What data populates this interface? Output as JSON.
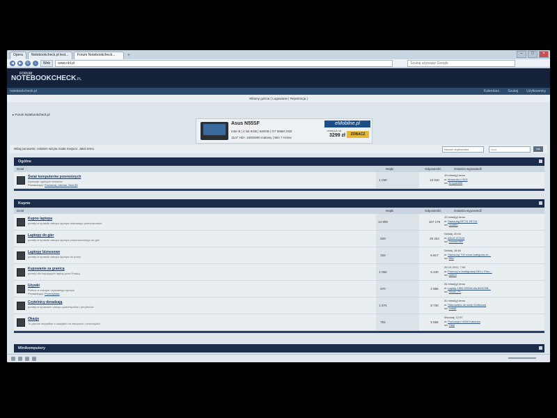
{
  "browser": {
    "tabs": [
      "Opera",
      "Notebookcheck.pl test...",
      "Forum Notebookcheck..."
    ],
    "nav_web_label": "Web",
    "url": "www.nbl.pl",
    "search_placeholder": "Szukaj używając Google"
  },
  "forum": {
    "logo_small": "FORUM",
    "logo_main": "NOTEBOOKCHECK",
    "logo_tld": ".PL",
    "site_link": "notebookcheck.pl",
    "top_links": [
      "Kalendarz",
      "Szukaj",
      "Użytkownicy"
    ],
    "welcome": "Witamy gościa ( Logowanie | Rejestracja )",
    "breadcrumb": "Forum Notebookcheck.pl",
    "greeting": "Witaj ponownie; ostatnie wizyta miała miejsce: Jakiś temu",
    "login_user_placeholder": "Nazwa użytkownika",
    "login_pass_placeholder": "••••••",
    "login_button": "Idź"
  },
  "banner": {
    "title": "Asus N55SF",
    "spec_line1": "Intel i5 | 4 lub 8GB | 640GB | GT 555M 2GB",
    "spec_line2": "15,6\" HD+ 1600x900 matowy | Win 7 Home",
    "shop": "eMobilne.pl",
    "price_label": "cena już od",
    "price": "3299 zł",
    "cta": "ZOBACZ"
  },
  "columns": {
    "forum": "Dział",
    "threads": "Wątki",
    "posts": "Odpowiedzi",
    "last": "Ostatnia wypowiedź"
  },
  "categories": [
    {
      "title": "Ogólne",
      "rows": [
        {
          "name": "Świat komputerów przenośnych",
          "desc": "Dyskusje ogólnych tematów",
          "moderators": "Porównaj, Lidman, Nick 85",
          "threads": "1 040",
          "posts": "13 010",
          "last_time": "19 minut(y) temu",
          "last_in": "Motorola z HDD",
          "last_by": "Krzysiek85"
        }
      ]
    },
    {
      "title": "Kupno",
      "rows": [
        {
          "name": "Kupno laptopa",
          "desc": "porady w sprawie zakupu laptopa dobranego przeznaczenie",
          "moderators": "",
          "threads": "14 809",
          "posts": "107 179",
          "last_time": "10 minut(y) temu",
          "last_in": "Samsung RF711 RF711",
          "last_by": "mcaftlo"
        },
        {
          "name": "Laptopy do gier",
          "desc": "porady w sprawie zakupu laptopa przeznaczonego do gier",
          "moderators": "",
          "threads": "829",
          "posts": "26 424",
          "last_time": "Dzisiaj, 20:04",
          "last_in": "ASUS G73JH",
          "last_by": "Damian989"
        },
        {
          "name": "Laptopy biznesowe",
          "desc": "porady w sprawie zakupu laptopa do pracy",
          "moderators": "",
          "threads": "334",
          "posts": "6 817",
          "last_time": "Dzisiaj, 18:54",
          "last_in": "Samsung 700 nowa kategoria nb...",
          "last_by": "Nito"
        },
        {
          "name": "Kupowanie za granicą",
          "desc": "porady dla kupujących laptop poza Polską",
          "moderators": "",
          "threads": "1 050",
          "posts": "6 240",
          "last_time": "29-10-2011, 7:54",
          "last_in": "Pomocy w konfiguracji DELL Prec...",
          "last_by": "antem"
        },
        {
          "name": "Używki",
          "desc": "Pomoc w zakupie używanego sprzętu",
          "moderators": "Przemysław",
          "threads": "670",
          "posts": "2 886",
          "last_time": "34 minut(y) temu",
          "last_in": "Laptop 1500-2000zł dla 8400 BB...",
          "last_by": "Micek_PL"
        },
        {
          "name": "Czytelnicy doradzają",
          "desc": "porady w sprawach zakupu podzespołów i peryferiów",
          "moderators": "",
          "threads": "1 574",
          "posts": "8 730",
          "last_time": "31 minut(y) temu",
          "last_in": "Stanowiska do karty Graficznej",
          "last_by": "cobalt"
        },
        {
          "name": "Okazje",
          "desc": "Tu piszcie wszystkie o okazjach na zakupach i promocjach",
          "moderators": "",
          "threads": "781",
          "posts": "5 555",
          "last_time": "Wczoraj, 12:57",
          "last_in": "Promocja z ADM Kabanka",
          "last_by": "Tikal"
        }
      ]
    },
    {
      "title": "Minikomputery",
      "rows": []
    }
  ]
}
